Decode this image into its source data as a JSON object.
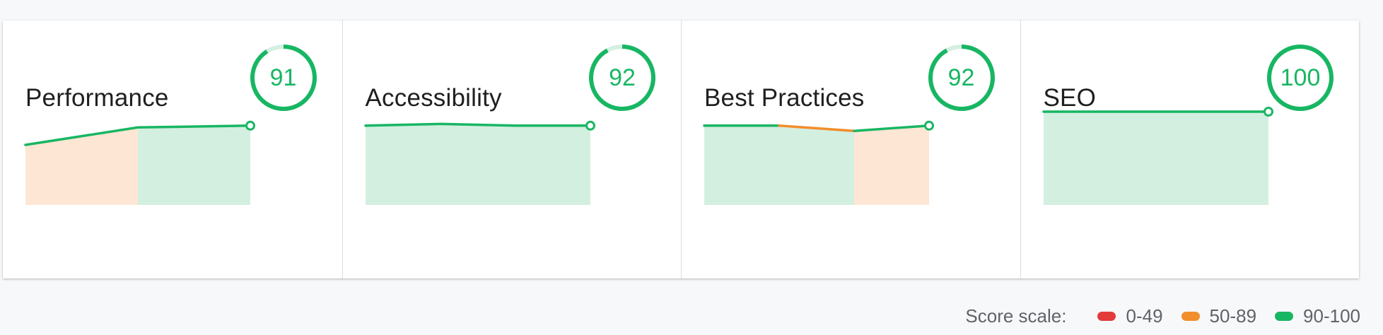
{
  "colors": {
    "pass": "#18b663",
    "average": "#f28d2b",
    "fail": "#e33b3b",
    "pass_fill": "#d3efe0",
    "average_fill": "#fee6d5",
    "gauge_track": "#d5efe1"
  },
  "categories": [
    {
      "title": "Performance",
      "score": "91",
      "history": [
        81,
        91,
        92
      ]
    },
    {
      "title": "Accessibility",
      "score": "92",
      "history": [
        92,
        93,
        92,
        92
      ]
    },
    {
      "title": "Best Practices",
      "score": "92",
      "history": [
        92,
        92,
        89,
        92
      ]
    },
    {
      "title": "SEO",
      "score": "100",
      "history": [
        100,
        100
      ]
    }
  ],
  "legend": {
    "label": "Score scale:",
    "items": [
      {
        "range": "0-49",
        "color": "#e33b3b"
      },
      {
        "range": "50-89",
        "color": "#f28d2b"
      },
      {
        "range": "90-100",
        "color": "#18b663"
      }
    ]
  }
}
